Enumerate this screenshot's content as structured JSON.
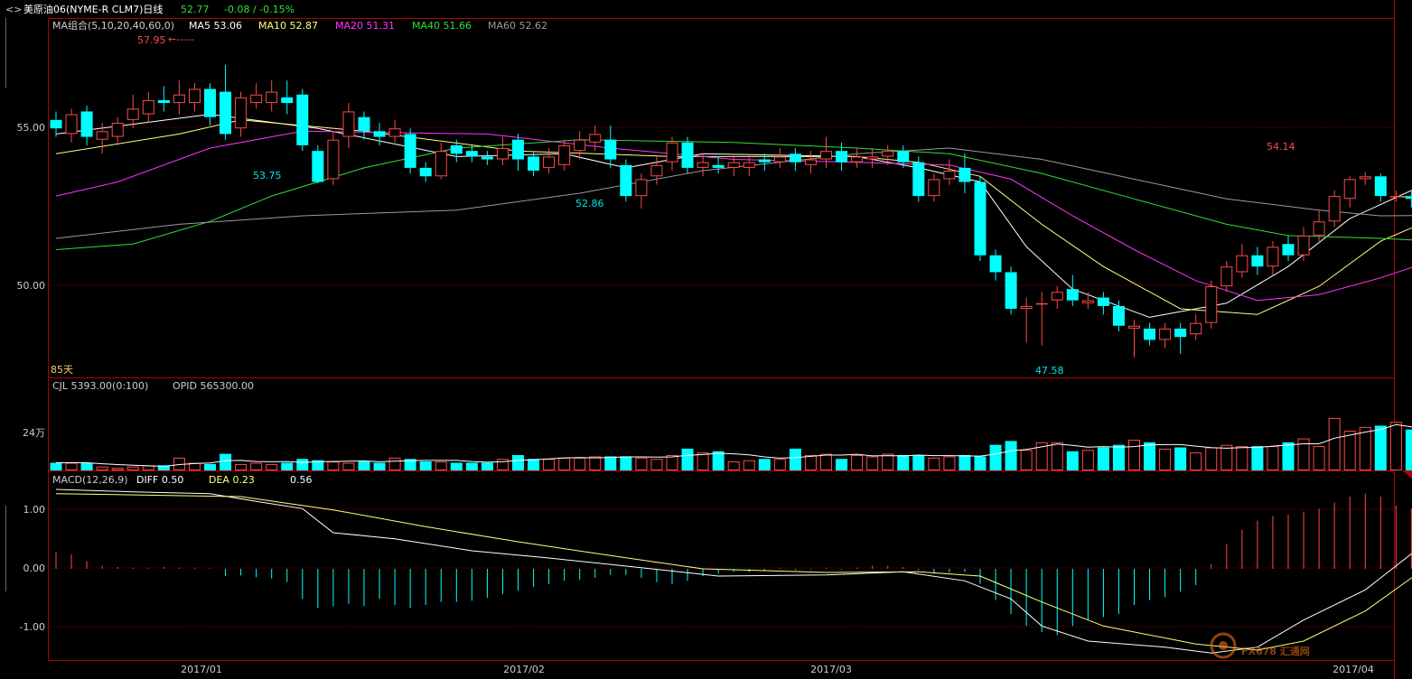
{
  "header": {
    "back_glyph": "<>",
    "title": "美原油06(NYME-R CLM7)日线",
    "last": "52.77",
    "change": "-0.08 / -0.15%"
  },
  "ma_legend": {
    "group": "MA组合(5,10,20,40,60,0)",
    "items": [
      {
        "label": "MA5 53.06",
        "color": "#ffffff"
      },
      {
        "label": "MA10 52.87",
        "color": "#ffff80"
      },
      {
        "label": "MA20 51.31",
        "color": "#ff33ff"
      },
      {
        "label": "MA40 51.66",
        "color": "#33dd33"
      },
      {
        "label": "MA60 52.62",
        "color": "#999999"
      }
    ]
  },
  "annotations": {
    "high_top": "57.95",
    "low_1": "53.75",
    "low_2": "52.86",
    "high_right": "54.14",
    "low_bottom": "47.58",
    "days": "85天"
  },
  "vol_legend": {
    "cjl": "CJL  5393.00(0:100)",
    "opid": "OPID  565300.00"
  },
  "macd_legend": {
    "label": "MACD(12,26,9)",
    "diff": "DIFF  0.50",
    "dea": "DEA  0.23",
    "macd": "0.56"
  },
  "y_labels": {
    "p55": "55.00",
    "p50": "50.00",
    "vol": "24万",
    "m1": "1.00",
    "m0": "0.00",
    "mneg": "-1.00"
  },
  "x_labels": [
    "2017/01",
    "2017/02",
    "2017/03",
    "2017/04"
  ],
  "watermark": "FX678 汇通网",
  "colors": {
    "up": "#ff4a4a",
    "down": "#00ffff",
    "grid": "#8a0000",
    "frame": "#b00000"
  },
  "chart_data": {
    "type": "candlestick",
    "price_ylim": [
      46.9,
      59.1
    ],
    "candles": [
      {
        "o": 56.0,
        "c": 55.7,
        "h": 56.3,
        "l": 55.4
      },
      {
        "o": 55.5,
        "c": 56.2,
        "h": 56.4,
        "l": 55.2
      },
      {
        "o": 56.3,
        "c": 55.4,
        "h": 56.5,
        "l": 55.1
      },
      {
        "o": 55.3,
        "c": 55.6,
        "h": 55.9,
        "l": 54.8
      },
      {
        "o": 55.4,
        "c": 55.9,
        "h": 56.1,
        "l": 55.1
      },
      {
        "o": 56.0,
        "c": 56.4,
        "h": 56.9,
        "l": 55.7
      },
      {
        "o": 56.2,
        "c": 56.7,
        "h": 57.0,
        "l": 55.9
      },
      {
        "o": 56.7,
        "c": 56.6,
        "h": 57.2,
        "l": 56.3
      },
      {
        "o": 56.6,
        "c": 56.9,
        "h": 57.4,
        "l": 56.2
      },
      {
        "o": 56.6,
        "c": 57.1,
        "h": 57.3,
        "l": 56.3
      },
      {
        "o": 57.1,
        "c": 56.1,
        "h": 57.3,
        "l": 55.8
      },
      {
        "o": 57.0,
        "c": 55.5,
        "h": 57.95,
        "l": 55.3
      },
      {
        "o": 55.7,
        "c": 56.8,
        "h": 57.0,
        "l": 55.4
      },
      {
        "o": 56.6,
        "c": 56.9,
        "h": 57.3,
        "l": 56.4
      },
      {
        "o": 56.6,
        "c": 57.0,
        "h": 57.4,
        "l": 56.3
      },
      {
        "o": 56.8,
        "c": 56.6,
        "h": 57.4,
        "l": 56.2
      },
      {
        "o": 56.9,
        "c": 55.1,
        "h": 57.1,
        "l": 54.9
      },
      {
        "o": 54.9,
        "c": 53.8,
        "h": 55.1,
        "l": 53.75
      },
      {
        "o": 53.9,
        "c": 55.3,
        "h": 55.6,
        "l": 53.7
      },
      {
        "o": 55.4,
        "c": 56.3,
        "h": 56.6,
        "l": 55.0
      },
      {
        "o": 56.1,
        "c": 55.6,
        "h": 56.3,
        "l": 55.3
      },
      {
        "o": 55.6,
        "c": 55.4,
        "h": 55.9,
        "l": 55.1
      },
      {
        "o": 55.4,
        "c": 55.7,
        "h": 56.0,
        "l": 55.2
      },
      {
        "o": 55.5,
        "c": 54.3,
        "h": 55.7,
        "l": 54.1
      },
      {
        "o": 54.3,
        "c": 54.0,
        "h": 54.5,
        "l": 53.8
      },
      {
        "o": 54.0,
        "c": 54.9,
        "h": 55.2,
        "l": 53.9
      },
      {
        "o": 55.1,
        "c": 54.8,
        "h": 55.3,
        "l": 54.5
      },
      {
        "o": 54.9,
        "c": 54.7,
        "h": 55.1,
        "l": 54.5
      },
      {
        "o": 54.7,
        "c": 54.6,
        "h": 54.9,
        "l": 54.4
      },
      {
        "o": 54.6,
        "c": 55.0,
        "h": 55.4,
        "l": 54.4
      },
      {
        "o": 55.3,
        "c": 54.6,
        "h": 55.5,
        "l": 54.2
      },
      {
        "o": 54.7,
        "c": 54.2,
        "h": 54.9,
        "l": 54.0
      },
      {
        "o": 54.3,
        "c": 54.7,
        "h": 55.0,
        "l": 54.1
      },
      {
        "o": 54.4,
        "c": 55.1,
        "h": 55.3,
        "l": 54.2
      },
      {
        "o": 54.9,
        "c": 55.3,
        "h": 55.6,
        "l": 54.6
      },
      {
        "o": 55.2,
        "c": 55.5,
        "h": 55.8,
        "l": 54.9
      },
      {
        "o": 55.3,
        "c": 54.6,
        "h": 55.8,
        "l": 54.3
      },
      {
        "o": 54.4,
        "c": 53.3,
        "h": 54.6,
        "l": 53.1
      },
      {
        "o": 53.3,
        "c": 53.9,
        "h": 54.1,
        "l": 52.86
      },
      {
        "o": 54.0,
        "c": 54.4,
        "h": 54.7,
        "l": 53.7
      },
      {
        "o": 54.5,
        "c": 55.2,
        "h": 55.4,
        "l": 54.2
      },
      {
        "o": 55.2,
        "c": 54.3,
        "h": 55.4,
        "l": 54.1
      },
      {
        "o": 54.3,
        "c": 54.5,
        "h": 54.8,
        "l": 54.0
      },
      {
        "o": 54.4,
        "c": 54.3,
        "h": 54.7,
        "l": 54.1
      },
      {
        "o": 54.3,
        "c": 54.5,
        "h": 54.8,
        "l": 54.0
      },
      {
        "o": 54.3,
        "c": 54.5,
        "h": 54.8,
        "l": 54.0
      },
      {
        "o": 54.6,
        "c": 54.5,
        "h": 54.8,
        "l": 54.2
      },
      {
        "o": 54.5,
        "c": 54.7,
        "h": 55.0,
        "l": 54.3
      },
      {
        "o": 54.8,
        "c": 54.5,
        "h": 55.0,
        "l": 54.2
      },
      {
        "o": 54.4,
        "c": 54.6,
        "h": 54.9,
        "l": 54.1
      },
      {
        "o": 54.6,
        "c": 54.9,
        "h": 55.4,
        "l": 54.3
      },
      {
        "o": 54.9,
        "c": 54.5,
        "h": 55.2,
        "l": 54.2
      },
      {
        "o": 54.5,
        "c": 54.7,
        "h": 55.0,
        "l": 54.3
      },
      {
        "o": 54.6,
        "c": 54.7,
        "h": 55.0,
        "l": 54.3
      },
      {
        "o": 54.7,
        "c": 54.9,
        "h": 55.1,
        "l": 54.4
      },
      {
        "o": 54.9,
        "c": 54.5,
        "h": 55.1,
        "l": 54.3
      },
      {
        "o": 54.5,
        "c": 53.3,
        "h": 54.7,
        "l": 53.1
      },
      {
        "o": 53.3,
        "c": 53.9,
        "h": 54.1,
        "l": 53.1
      },
      {
        "o": 53.9,
        "c": 54.2,
        "h": 54.6,
        "l": 53.7
      },
      {
        "o": 54.3,
        "c": 53.8,
        "h": 54.8,
        "l": 53.4
      },
      {
        "o": 53.8,
        "c": 51.2,
        "h": 54.0,
        "l": 51.0
      },
      {
        "o": 51.2,
        "c": 50.6,
        "h": 51.4,
        "l": 50.3
      },
      {
        "o": 50.6,
        "c": 49.3,
        "h": 50.8,
        "l": 49.1
      },
      {
        "o": 49.3,
        "c": 49.4,
        "h": 49.7,
        "l": 48.1
      },
      {
        "o": 49.5,
        "c": 49.5,
        "h": 49.9,
        "l": 48.0
      },
      {
        "o": 49.6,
        "c": 49.9,
        "h": 50.1,
        "l": 49.3
      },
      {
        "o": 50.0,
        "c": 49.6,
        "h": 50.5,
        "l": 49.4
      },
      {
        "o": 49.5,
        "c": 49.6,
        "h": 49.9,
        "l": 49.3
      },
      {
        "o": 49.7,
        "c": 49.4,
        "h": 49.9,
        "l": 49.1
      },
      {
        "o": 49.4,
        "c": 48.7,
        "h": 49.6,
        "l": 48.5
      },
      {
        "o": 48.6,
        "c": 48.7,
        "h": 48.9,
        "l": 47.58
      },
      {
        "o": 48.6,
        "c": 48.2,
        "h": 48.8,
        "l": 48.0
      },
      {
        "o": 48.2,
        "c": 48.6,
        "h": 48.8,
        "l": 47.9
      },
      {
        "o": 48.6,
        "c": 48.3,
        "h": 48.8,
        "l": 47.7
      },
      {
        "o": 48.4,
        "c": 48.8,
        "h": 49.1,
        "l": 48.2
      },
      {
        "o": 48.8,
        "c": 50.1,
        "h": 50.3,
        "l": 48.6
      },
      {
        "o": 50.1,
        "c": 50.8,
        "h": 51.0,
        "l": 49.9
      },
      {
        "o": 50.6,
        "c": 51.2,
        "h": 51.6,
        "l": 50.4
      },
      {
        "o": 51.2,
        "c": 50.8,
        "h": 51.5,
        "l": 50.5
      },
      {
        "o": 50.8,
        "c": 51.5,
        "h": 51.7,
        "l": 50.5
      },
      {
        "o": 51.6,
        "c": 51.2,
        "h": 51.9,
        "l": 51.0
      },
      {
        "o": 51.2,
        "c": 51.9,
        "h": 52.2,
        "l": 51.0
      },
      {
        "o": 51.9,
        "c": 52.4,
        "h": 52.8,
        "l": 51.7
      },
      {
        "o": 52.4,
        "c": 53.3,
        "h": 53.5,
        "l": 52.2
      },
      {
        "o": 53.2,
        "c": 53.9,
        "h": 54.0,
        "l": 52.9
      },
      {
        "o": 53.9,
        "c": 54.0,
        "h": 54.14,
        "l": 53.7
      },
      {
        "o": 54.0,
        "c": 53.3,
        "h": 54.1,
        "l": 53.1
      },
      {
        "o": 53.3,
        "c": 53.3,
        "h": 53.5,
        "l": 53.1
      },
      {
        "o": 53.3,
        "c": 53.2,
        "h": 53.5,
        "l": 52.9
      },
      {
        "o": 53.3,
        "c": 52.8,
        "h": 53.3,
        "l": 52.6
      },
      {
        "o": 52.85,
        "c": 52.77,
        "h": 52.9,
        "l": 52.6
      }
    ],
    "ma_series": [
      {
        "name": "MA5",
        "color": "#ffffff",
        "pts": [
          [
            0,
            55.5
          ],
          [
            10,
            56.2
          ],
          [
            17,
            55.7
          ],
          [
            26,
            54.7
          ],
          [
            33,
            54.8
          ],
          [
            37,
            54.3
          ],
          [
            42,
            54.8
          ],
          [
            52,
            54.7
          ],
          [
            56,
            54.3
          ],
          [
            60,
            53.8
          ],
          [
            63,
            51.5
          ],
          [
            66,
            50.0
          ],
          [
            71,
            49.0
          ],
          [
            76,
            49.5
          ],
          [
            80,
            50.8
          ],
          [
            84,
            52.5
          ],
          [
            88,
            53.5
          ],
          [
            91,
            53.1
          ]
        ]
      },
      {
        "name": "MA10",
        "color": "#ffff80",
        "pts": [
          [
            0,
            54.8
          ],
          [
            8,
            55.5
          ],
          [
            12,
            56.0
          ],
          [
            20,
            55.6
          ],
          [
            30,
            54.9
          ],
          [
            40,
            54.7
          ],
          [
            52,
            54.7
          ],
          [
            56,
            54.5
          ],
          [
            60,
            54.0
          ],
          [
            64,
            52.3
          ],
          [
            68,
            50.8
          ],
          [
            73,
            49.3
          ],
          [
            78,
            49.1
          ],
          [
            82,
            50.1
          ],
          [
            86,
            51.7
          ],
          [
            91,
            52.87
          ]
        ]
      },
      {
        "name": "MA20",
        "color": "#ff33ff",
        "pts": [
          [
            0,
            53.3
          ],
          [
            4,
            53.8
          ],
          [
            10,
            55.0
          ],
          [
            16,
            55.6
          ],
          [
            28,
            55.5
          ],
          [
            36,
            55.0
          ],
          [
            44,
            54.6
          ],
          [
            52,
            54.5
          ],
          [
            58,
            54.4
          ],
          [
            62,
            53.9
          ],
          [
            66,
            52.6
          ],
          [
            70,
            51.4
          ],
          [
            74,
            50.3
          ],
          [
            78,
            49.6
          ],
          [
            82,
            49.8
          ],
          [
            86,
            50.4
          ],
          [
            91,
            51.31
          ]
        ]
      },
      {
        "name": "MA40",
        "color": "#33dd33",
        "pts": [
          [
            0,
            51.4
          ],
          [
            5,
            51.6
          ],
          [
            10,
            52.4
          ],
          [
            14,
            53.3
          ],
          [
            20,
            54.3
          ],
          [
            26,
            55.0
          ],
          [
            34,
            55.3
          ],
          [
            44,
            55.2
          ],
          [
            52,
            55.0
          ],
          [
            58,
            54.8
          ],
          [
            64,
            54.1
          ],
          [
            70,
            53.2
          ],
          [
            76,
            52.3
          ],
          [
            80,
            51.9
          ],
          [
            86,
            51.8
          ],
          [
            91,
            51.66
          ]
        ]
      },
      {
        "name": "MA60",
        "color": "#999999",
        "pts": [
          [
            0,
            51.8
          ],
          [
            8,
            52.3
          ],
          [
            16,
            52.6
          ],
          [
            26,
            52.8
          ],
          [
            34,
            53.4
          ],
          [
            42,
            54.2
          ],
          [
            52,
            54.8
          ],
          [
            58,
            55.0
          ],
          [
            64,
            54.6
          ],
          [
            70,
            53.9
          ],
          [
            76,
            53.2
          ],
          [
            82,
            52.8
          ],
          [
            86,
            52.6
          ],
          [
            91,
            52.62
          ]
        ]
      }
    ],
    "vol_ylim": [
      0,
      300000
    ],
    "volume": [
      30000,
      30000,
      30000,
      15000,
      10000,
      15000,
      20000,
      20000,
      50000,
      30000,
      25000,
      65000,
      25000,
      30000,
      25000,
      30000,
      45000,
      40000,
      35000,
      30000,
      35000,
      30000,
      50000,
      45000,
      35000,
      35000,
      30000,
      30000,
      30000,
      45000,
      60000,
      45000,
      45000,
      50000,
      50000,
      55000,
      55000,
      55000,
      50000,
      45000,
      60000,
      85000,
      70000,
      75000,
      35000,
      40000,
      45000,
      45000,
      85000,
      60000,
      65000,
      45000,
      60000,
      55000,
      65000,
      60000,
      60000,
      50000,
      55000,
      60000,
      55000,
      100000,
      115000,
      80000,
      110000,
      110000,
      75000,
      80000,
      90000,
      100000,
      120000,
      110000,
      85000,
      90000,
      70000,
      90000,
      100000,
      95000,
      95000,
      95000,
      110000,
      125000,
      95000,
      205000,
      155000,
      170000,
      175000,
      190000,
      160000,
      145000,
      300000,
      10000
    ],
    "macd_ylim": [
      -1.5,
      1.35
    ],
    "macd_hist": [
      0.28,
      0.24,
      0.13,
      0.05,
      0.03,
      0.02,
      0.02,
      0.03,
      0.02,
      0.02,
      0.01,
      -0.12,
      -0.11,
      -0.14,
      -0.16,
      -0.22,
      -0.5,
      -0.65,
      -0.62,
      -0.58,
      -0.62,
      -0.5,
      -0.6,
      -0.65,
      -0.6,
      -0.55,
      -0.55,
      -0.53,
      -0.48,
      -0.42,
      -0.36,
      -0.3,
      -0.25,
      -0.2,
      -0.18,
      -0.15,
      -0.1,
      -0.1,
      -0.15,
      -0.22,
      -0.25,
      -0.2,
      -0.12,
      -0.08,
      -0.05,
      -0.05,
      -0.03,
      0.02,
      -0.02,
      -0.01,
      0.02,
      -0.01,
      0.02,
      0.05,
      0.05,
      0.03,
      -0.02,
      -0.08,
      -0.06,
      -0.05,
      -0.25,
      -0.52,
      -0.75,
      -0.95,
      -1.05,
      -1.1,
      -0.95,
      -0.85,
      -0.8,
      -0.75,
      -0.6,
      -0.52,
      -0.47,
      -0.38,
      -0.27,
      0.08,
      0.42,
      0.65,
      0.8,
      0.88,
      0.9,
      0.95,
      1.0,
      1.1,
      1.2,
      1.25,
      1.2,
      1.05,
      1.0,
      0.88,
      0.75,
      0.56
    ],
    "diff": {
      "color": "#ffffff",
      "pts": [
        [
          0,
          1.32
        ],
        [
          5,
          1.28
        ],
        [
          10,
          1.25
        ],
        [
          13,
          1.12
        ],
        [
          16,
          1.0
        ],
        [
          18,
          0.6
        ],
        [
          22,
          0.5
        ],
        [
          27,
          0.3
        ],
        [
          32,
          0.18
        ],
        [
          38,
          0.02
        ],
        [
          43,
          -0.12
        ],
        [
          50,
          -0.1
        ],
        [
          55,
          -0.05
        ],
        [
          59,
          -0.2
        ],
        [
          62,
          -0.5
        ],
        [
          64,
          -0.95
        ],
        [
          67,
          -1.2
        ],
        [
          72,
          -1.3
        ],
        [
          75,
          -1.4
        ],
        [
          78,
          -1.3
        ],
        [
          81,
          -0.85
        ],
        [
          85,
          -0.35
        ],
        [
          88,
          0.25
        ],
        [
          90,
          0.5
        ],
        [
          91,
          0.5
        ]
      ]
    },
    "dea": {
      "color": "#ffff80",
      "pts": [
        [
          0,
          1.25
        ],
        [
          12,
          1.2
        ],
        [
          18,
          0.98
        ],
        [
          24,
          0.7
        ],
        [
          30,
          0.45
        ],
        [
          36,
          0.22
        ],
        [
          42,
          0.0
        ],
        [
          50,
          -0.06
        ],
        [
          56,
          -0.05
        ],
        [
          60,
          -0.12
        ],
        [
          64,
          -0.55
        ],
        [
          68,
          -0.95
        ],
        [
          74,
          -1.25
        ],
        [
          78,
          -1.35
        ],
        [
          81,
          -1.2
        ],
        [
          85,
          -0.7
        ],
        [
          88,
          -0.15
        ],
        [
          91,
          0.23
        ]
      ]
    }
  }
}
